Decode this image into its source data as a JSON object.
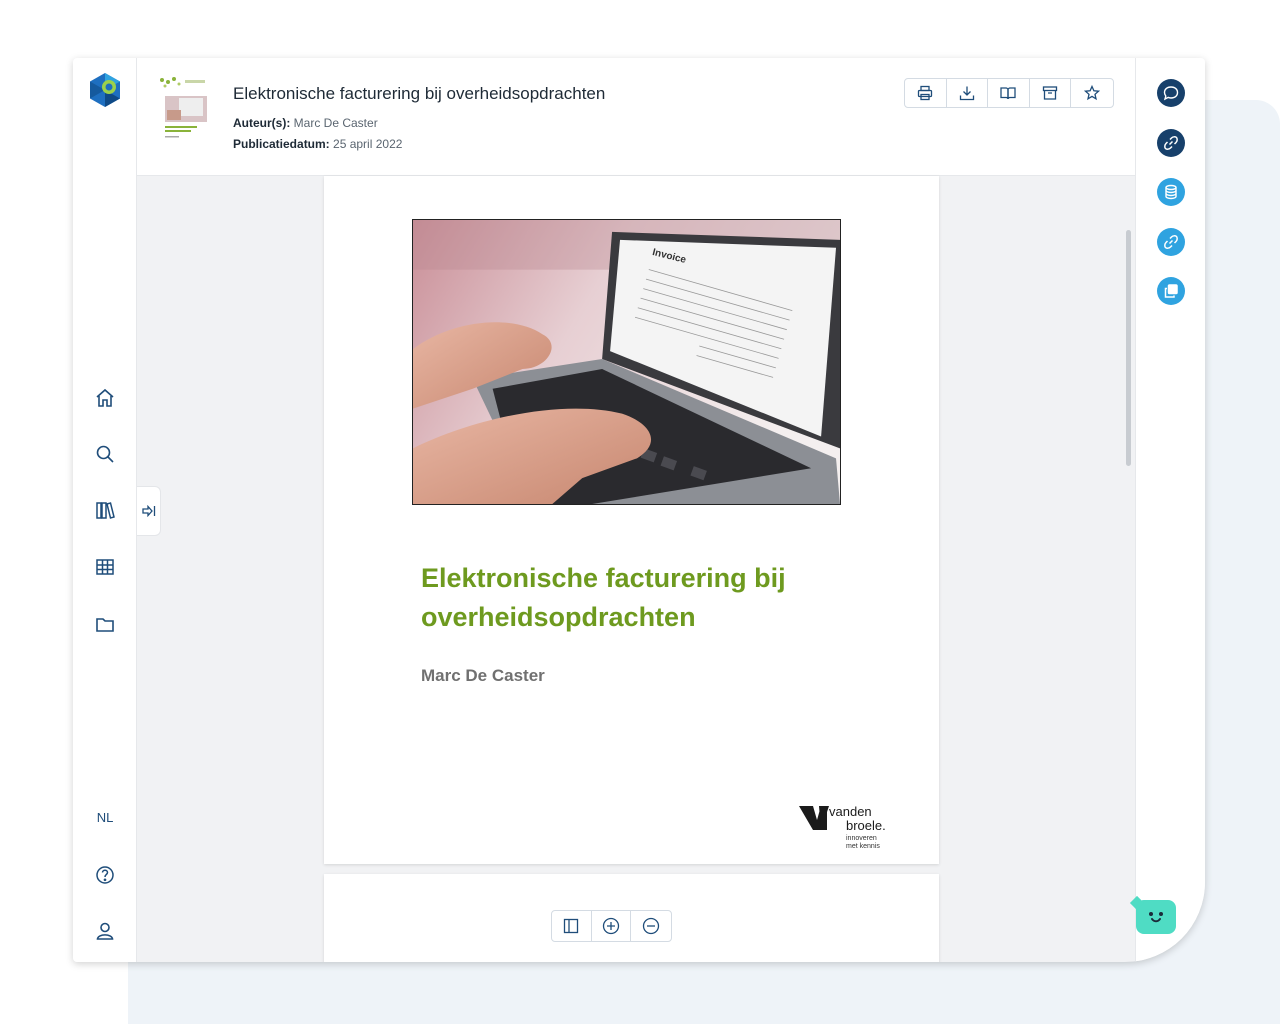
{
  "document": {
    "title": "Elektronische facturering bij overheidsopdrachten",
    "author_label": "Auteur(s):",
    "author": "Marc De Caster",
    "date_label": "Publicatiedatum:",
    "date": "25 april 2022"
  },
  "toolbar": {
    "icons": [
      "printer-icon",
      "download-icon",
      "book-open-icon",
      "archive-icon",
      "star-icon"
    ]
  },
  "sidebar": {
    "icons": [
      "home-icon",
      "search-icon",
      "library-icon",
      "table-icon",
      "folder-icon"
    ],
    "language": "NL",
    "bottom_icons": [
      "help-icon",
      "user-icon"
    ]
  },
  "right_panel": {
    "icons": [
      "comment-icon",
      "link-icon",
      "database-icon",
      "link-icon",
      "copy-icon"
    ],
    "colors": {
      "dark": "#17406b",
      "light": "#2fa3e0"
    }
  },
  "cover": {
    "title": "Elektronische facturering bij overheidsopdrachten",
    "author": "Marc De Caster",
    "photo_text": "Invoice",
    "publisher_line1": "vanden",
    "publisher_line2": "broele.",
    "publisher_tag1": "innoveren",
    "publisher_tag2": "met kennis",
    "title_color": "#6e9a1f"
  },
  "zoom_controls": {
    "icons": [
      "sidebar-toggle-icon",
      "zoom-in-icon",
      "zoom-out-icon"
    ]
  },
  "chatbot": {
    "icon": "chatbot-face-icon",
    "color": "#4fdcc4"
  }
}
